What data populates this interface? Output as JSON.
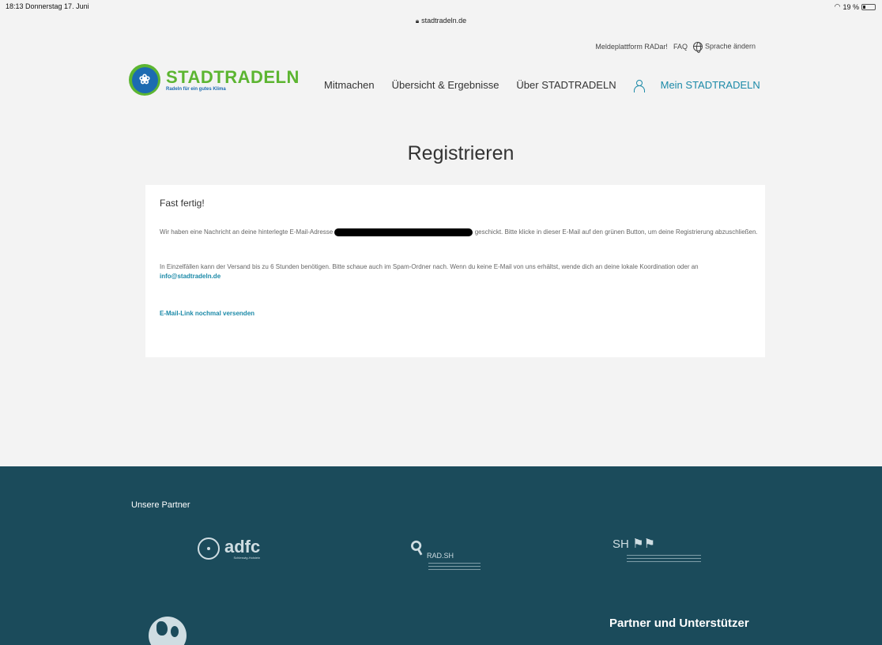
{
  "status_bar": {
    "time_date": "18:13  Donnerstag 17. Juni",
    "battery": "19 %",
    "battery_level": 0.19
  },
  "browser": {
    "url": "stadtradeln.de"
  },
  "header": {
    "top_links": [
      "Meldeplattform RADar!",
      "FAQ"
    ],
    "language": "Sprache ändern",
    "logo": {
      "name": "STADTRADELN",
      "tagline": "Radeln für ein gutes Klima"
    },
    "nav": [
      "Mitmachen",
      "Übersicht & Ergebnisse",
      "Über STADTRADELN"
    ],
    "account": "Mein STADTRADELN"
  },
  "main": {
    "title": "Registrieren",
    "heading": "Fast fertig!",
    "p1_before": "Wir haben eine Nachricht an deine hinterlegte E-Mail-Adresse",
    "p1_after": "geschickt. Bitte klicke in dieser E-Mail auf den grünen Button, um deine Registrierung abzuschließen.",
    "p2": "In Einzelfällen kann der Versand bis zu 6 Stunden benötigen. Bitte schaue auch im Spam-Ordner nach. Wenn du keine E-Mail von uns erhältst, wende dich an deine lokale Koordination oder an",
    "email_link": "info@stadtradeln.de",
    "resend": "E-Mail-Link nochmal versenden"
  },
  "footer": {
    "partners_title": "Unsere Partner",
    "partner_logos": {
      "adfc": "adfc",
      "adfc_sub": "Schleswig-Holstein",
      "radsh": "RAD.SH",
      "sh": "SH"
    },
    "supporters_title": "Partner und Unterstützer"
  }
}
